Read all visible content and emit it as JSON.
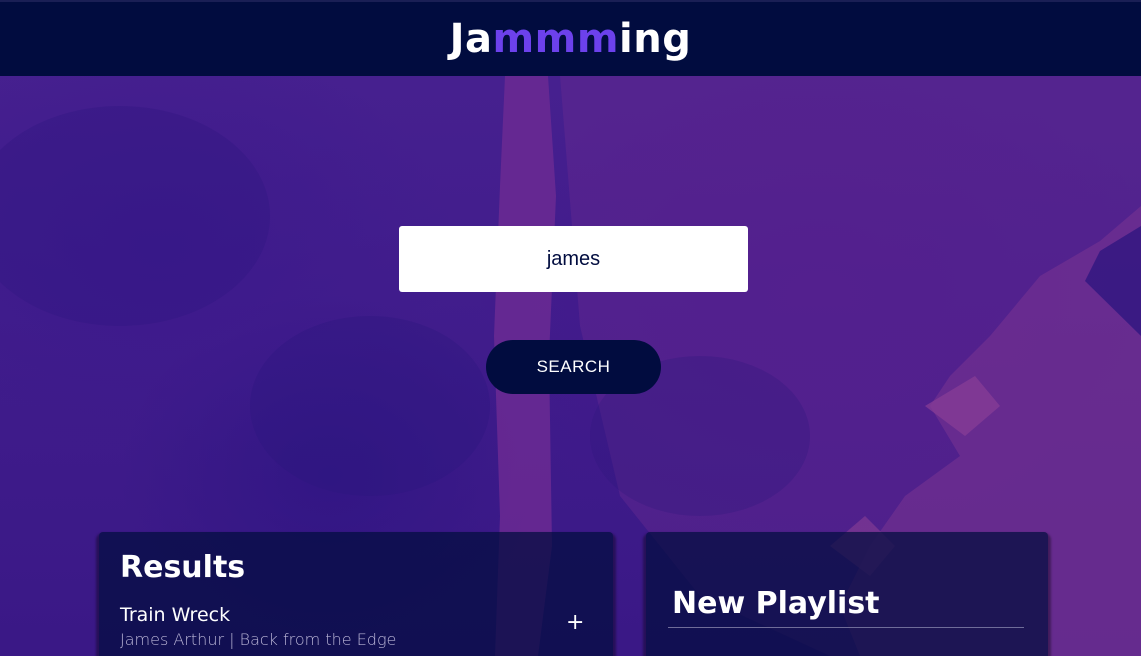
{
  "header": {
    "logo_prefix": "Ja",
    "logo_accent": "mmm",
    "logo_suffix": "ing"
  },
  "search": {
    "value": "james",
    "button_label": "SEARCH"
  },
  "results": {
    "title": "Results",
    "tracks": [
      {
        "name": "Train Wreck",
        "info": "James Arthur | Back from the Edge",
        "action": "+"
      }
    ]
  },
  "playlist": {
    "name": "New Playlist"
  },
  "colors": {
    "header_bg": "#010c3f",
    "accent": "#6c41ec",
    "background": "#3d1a86"
  }
}
